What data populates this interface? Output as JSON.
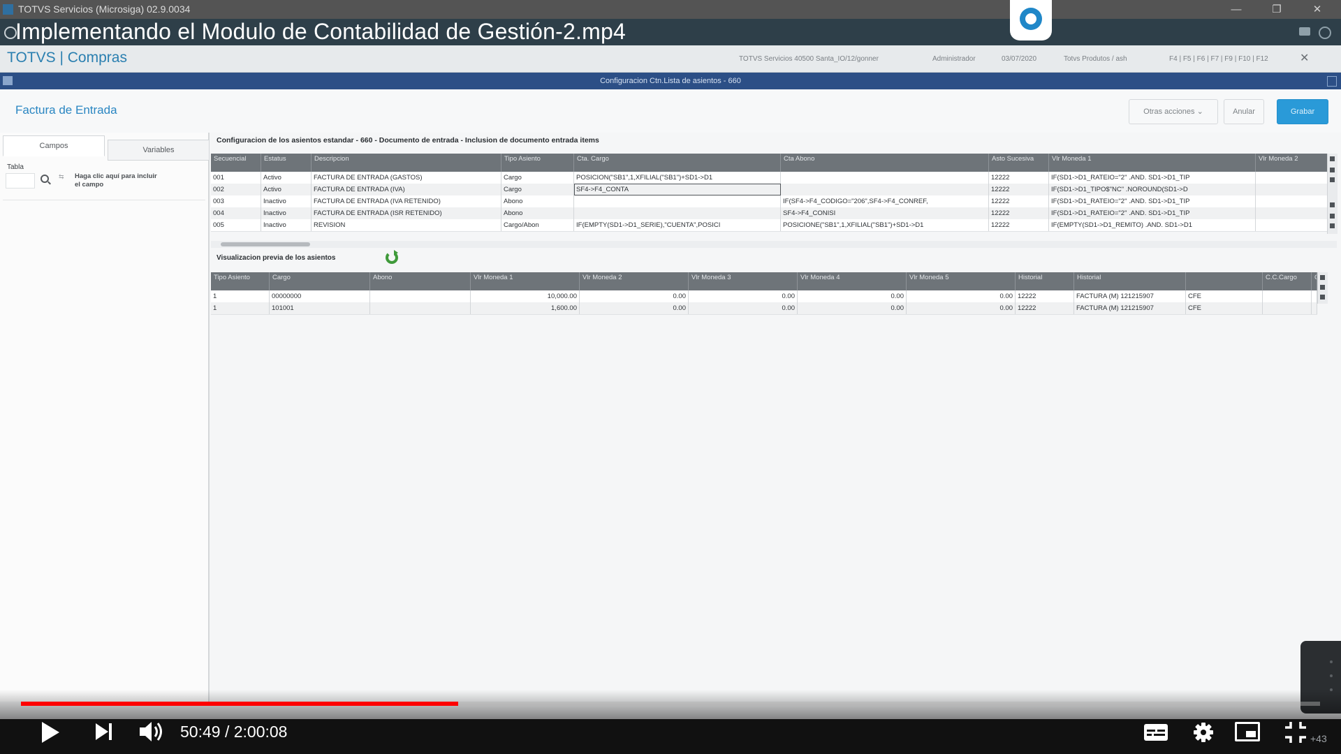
{
  "window": {
    "title": "TOTVS Servicios (Microsiga) 02.9.0034",
    "controls": [
      "—",
      "❐",
      "✕"
    ]
  },
  "video": {
    "title": "Implementando el Modulo de Contabilidad de Gestión-2.mp4",
    "time": "50:49 / 2:00:08",
    "progress_played": 0.3366,
    "progress_buffered": 0.3,
    "speed_badge": "+43"
  },
  "app": {
    "brand": "TOTVS | Compras",
    "info": [
      "TOTVS Servicios 40500 Santa_IO/12/gonner",
      "Administrador",
      "03/07/2020",
      "Totvs Produtos / ash",
      "F4 | F5 | F6 | F7 | F9 | F10 | F12"
    ],
    "dialog_title": "Configuracion Ctn.Lista de asientos - 660",
    "form_title": "Factura de Entrada",
    "actions": {
      "other": "Otras acciones",
      "cancel": "Anular",
      "save": "Grabar"
    }
  },
  "left_panel": {
    "tabs": [
      "Campos",
      "Variables"
    ],
    "table_label": "Tabla",
    "hint": "Haga clic aquí para incluir el campo"
  },
  "section": {
    "title": "Configuracion de los asientos estandar - 660 - Documento de entrada - Inclusion de documento entrada items"
  },
  "entries_grid": {
    "columns": [
      "Secuencial",
      "Estatus",
      "Descripcion",
      "Tipo Asiento",
      "Cta. Cargo",
      "Cta Abono",
      "Asto Sucesiva",
      "Vlr Moneda 1",
      "Vlr Moneda 2"
    ],
    "rows": [
      [
        "001",
        "Activo",
        "FACTURA DE ENTRADA (GASTOS)",
        "Cargo",
        "POSICION(\"SB1\",1,XFILIAL(\"SB1\")+SD1->D1",
        "",
        "12222",
        "IF(SD1->D1_RATEIO=\"2\" .AND. SD1->D1_TIP",
        ""
      ],
      [
        "002",
        "Activo",
        "FACTURA DE ENTRADA (IVA)",
        "Cargo",
        "SF4->F4_CONTA",
        "",
        "12222",
        "IF(SD1->D1_TIPO$\"NC\" .NOROUND(SD1->D",
        ""
      ],
      [
        "003",
        "Inactivo",
        "FACTURA DE ENTRADA (IVA RETENIDO)",
        "Abono",
        "",
        "IF(SF4->F4_CODIGO=\"206\",SF4->F4_CONREF,",
        "12222",
        "IF(SD1->D1_RATEIO=\"2\" .AND. SD1->D1_TIP",
        ""
      ],
      [
        "004",
        "Inactivo",
        "FACTURA DE ENTRADA (ISR RETENIDO)",
        "Abono",
        "",
        "SF4->F4_CONISI",
        "12222",
        "IF(SD1->D1_RATEIO=\"2\" .AND. SD1->D1_TIP",
        ""
      ],
      [
        "005",
        "Inactivo",
        "REVISION",
        "Cargo/Abon",
        "IF(EMPTY(SD1->D1_SERIE),\"CUENTA\",POSICI",
        "POSICIONE(\"SB1\",1,XFILIAL(\"SB1\")+SD1->D1",
        "12222",
        "IF(EMPTY(SD1->D1_REMITO) .AND. SD1->D1",
        ""
      ]
    ]
  },
  "preview": {
    "title": "Visualizacion previa de los asientos",
    "columns": [
      "Tipo Asiento",
      "Cargo",
      "Abono",
      "Vlr Moneda 1",
      "Vlr Moneda 2",
      "Vlr Moneda 3",
      "Vlr Moneda 4",
      "Vlr Moneda 5",
      "Historial",
      "Historial",
      "",
      "C.C.Cargo",
      "C"
    ],
    "rows": [
      [
        "1",
        "00000000",
        "",
        "10,000.00",
        "0.00",
        "0.00",
        "0.00",
        "0.00",
        "12222",
        "FACTURA (M) 121215907",
        "CFE",
        "",
        ""
      ],
      [
        "1",
        "101001",
        "",
        "1,600.00",
        "0.00",
        "0.00",
        "0.00",
        "0.00",
        "12222",
        "FACTURA (M) 121215907",
        "CFE",
        "",
        ""
      ]
    ]
  }
}
